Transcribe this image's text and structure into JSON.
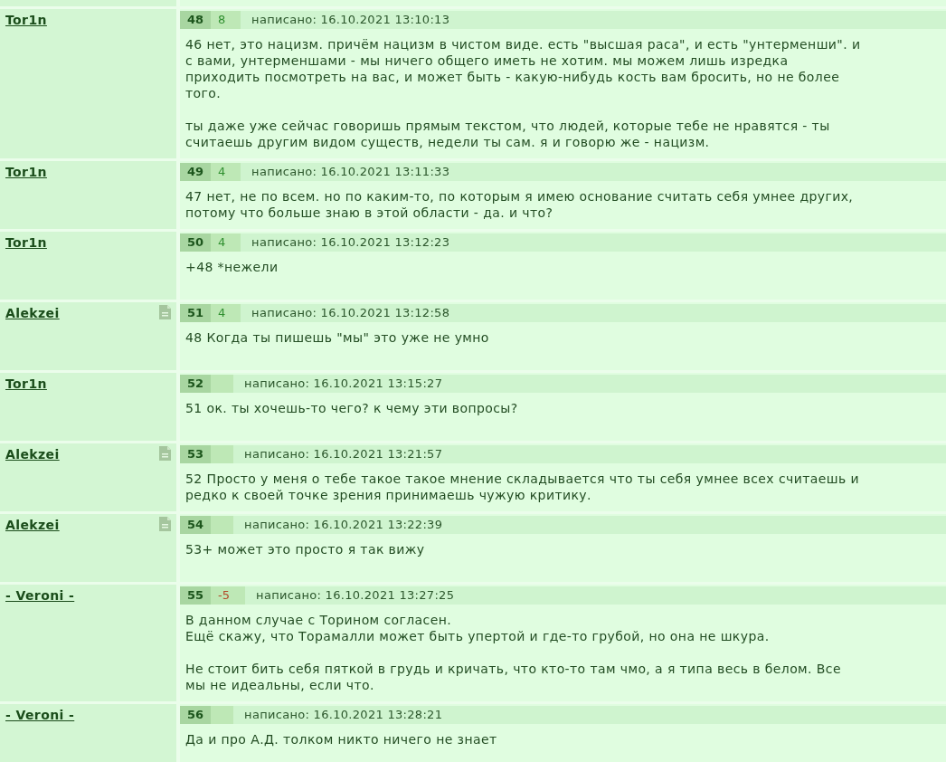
{
  "posts": [
    {
      "author": "Tor1n",
      "doc_icon": false,
      "number": "48",
      "rating": "8",
      "negative": false,
      "date_label": "написано: 16.10.2021 13:10:13",
      "paragraphs": [
        "46 нет, это нацизм. причём нацизм в чистом виде. есть \"высшая раса\", и есть \"унтерменши\". и\nс вами, унтерменшами - мы ничего общего иметь не хотим. мы можем лишь изредка\nприходить посмотреть на вас, и может быть - какую-нибудь кость вам бросить, но не более\nтого.",
        "ты даже уже сейчас говоришь прямым текстом, что людей, которые тебе не нравятся - ты\nсчитаешь другим видом существ, недели ты сам. я и говорю же - нацизм."
      ]
    },
    {
      "author": "Tor1n",
      "doc_icon": false,
      "number": "49",
      "rating": "4",
      "negative": false,
      "date_label": "написано: 16.10.2021 13:11:33",
      "paragraphs": [
        "47 нет, не по всем. но по каким-то, по которым я имею основание считать себя умнее других,\nпотому что больше знаю в этой области - да. и что?"
      ]
    },
    {
      "author": "Tor1n",
      "doc_icon": false,
      "number": "50",
      "rating": "4",
      "negative": false,
      "date_label": "написано: 16.10.2021 13:12:23",
      "paragraphs": [
        "+48 *нежели"
      ]
    },
    {
      "author": "Alekzei",
      "doc_icon": true,
      "number": "51",
      "rating": "4",
      "negative": false,
      "date_label": "написано: 16.10.2021 13:12:58",
      "paragraphs": [
        "48 Когда ты пишешь \"мы\" это уже не умно"
      ]
    },
    {
      "author": "Tor1n",
      "doc_icon": false,
      "number": "52",
      "date_label": "написано: 16.10.2021 13:15:27",
      "paragraphs": [
        "51 ок. ты хочешь-то чего? к чему эти вопросы?"
      ]
    },
    {
      "author": "Alekzei",
      "doc_icon": true,
      "number": "53",
      "date_label": "написано: 16.10.2021 13:21:57",
      "paragraphs": [
        "52 Просто у меня о тебе такое такое мнение складывается что ты себя умнее всех считаешь и\nредко к своей точке зрения принимаешь чужую критику."
      ]
    },
    {
      "author": "Alekzei",
      "doc_icon": true,
      "number": "54",
      "date_label": "написано: 16.10.2021 13:22:39",
      "paragraphs": [
        "53+ может это просто я так вижу"
      ]
    },
    {
      "author": "- Veroni -",
      "doc_icon": false,
      "number": "55",
      "rating": "-5",
      "negative": true,
      "date_label": "написано: 16.10.2021 13:27:25",
      "paragraphs": [
        "В данном случае с Торином согласен.\nЕщё скажу, что Торамалли может быть упертой и где-то грубой, но она не шкура.",
        "Не стоит бить себя пяткой в грудь и кричать, что кто-то там чмо, а я типа весь в белом. Все\nмы не идеальны, если что."
      ]
    },
    {
      "author": "- Veroni -",
      "doc_icon": false,
      "number": "56",
      "date_label": "написано: 16.10.2021 13:28:21",
      "paragraphs": [
        "Да и про А.Д. толком никто ничего не знает"
      ]
    }
  ]
}
